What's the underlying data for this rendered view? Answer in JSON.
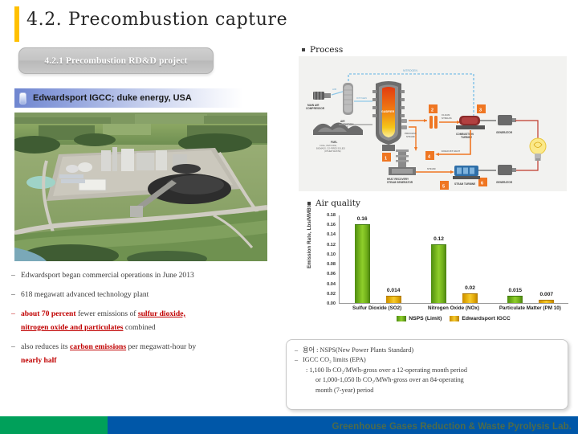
{
  "slide": {
    "title": "4.2. Precombustion capture",
    "subsection": "4.2.1 Precombustion RD&D project",
    "project_label": "Edwardsport IGCC; duke energy, USA",
    "accent_color": "#FFC000"
  },
  "sections": {
    "process_heading": "Process",
    "air_quality_heading": "Air quality"
  },
  "process_diagram": {
    "nitrogen_label": "NITROGEN",
    "air_label": "AIR",
    "oxygen_label": "OXYGEN",
    "clean_syngas_label": "CLEAN SYNGAS",
    "process_steam_label": "PROCESS STEAM",
    "exhaust_heat_label": "EXHAUST HEAT",
    "steam_label": "STEAM",
    "main_air_compressor": "MAIN AIR COMPRESSOR",
    "air_separation_unit": "AIR SEPARATION UNIT",
    "gasifier": "GASIFIER",
    "fuel_label": "FUEL",
    "fuel_sub": "COAL, PETCOKE, BIOMASS, CO-FIRED SOLIDS (OTHER WASTE)",
    "combustion_turbine": "COMBUSTION TURBINE",
    "generator": "GENERATOR",
    "heat_recovery": "HEAT RECOVERY STEAM GENERATOR",
    "steam_turbine": "STEAM TURBINE",
    "step_numbers": [
      "1",
      "2",
      "3",
      "4",
      "5",
      "6"
    ]
  },
  "bullets": [
    {
      "marker": "–",
      "marker_red": false,
      "parts": [
        {
          "text": "Edwardsport began commercial operations in June 2013",
          "style": "plain"
        }
      ]
    },
    {
      "marker": "–",
      "marker_red": false,
      "parts": [
        {
          "text": "618 megawatt advanced technology plant",
          "style": "plain"
        }
      ]
    },
    {
      "marker": "–",
      "marker_red": true,
      "parts": [
        {
          "text": "about 70 percent",
          "style": "em-red"
        },
        {
          "text": " fewer emissions of ",
          "style": "plain"
        },
        {
          "text": "sulfur dioxide,",
          "style": "u-red"
        }
      ],
      "continuation": [
        {
          "text": "nitrogen oxide and particulates",
          "style": "u-red"
        },
        {
          "text": " combined",
          "style": "plain"
        }
      ]
    },
    {
      "marker": "–",
      "marker_red": false,
      "parts": [
        {
          "text": "also reduces its ",
          "style": "plain"
        },
        {
          "text": "carbon emissions",
          "style": "u-red"
        },
        {
          "text": " per megawatt-hour by",
          "style": "plain"
        }
      ],
      "continuation": [
        {
          "text": "nearly half",
          "style": "em-red"
        }
      ]
    }
  ],
  "chart_data": {
    "type": "bar",
    "title": "",
    "xlabel": "",
    "ylabel": "Emission Rate, Lbs/MMBtu",
    "ylim": [
      0.0,
      0.18
    ],
    "ytick_labels": [
      "0.18",
      "0.16",
      "0.14",
      "0.12",
      "0.10",
      "0.08",
      "0.06",
      "0.04",
      "0.02",
      "0.00"
    ],
    "grid": false,
    "legend_position": "bottom",
    "categories": [
      "Sulfur Dioxide (SO2)",
      "Nitrogen Oxide (NOx)",
      "Particulate Matter (PM 10)"
    ],
    "series": [
      {
        "name": "NSPS (Limit)",
        "color": "#7FBF20",
        "values": [
          0.16,
          0.12,
          0.015
        ],
        "labels": [
          "0.16",
          "0.12",
          "0.015"
        ]
      },
      {
        "name": "Edwardsport IGCC",
        "color": "#E8AE00",
        "values": [
          0.014,
          0.02,
          0.007
        ],
        "labels": [
          "0.014",
          "0.02",
          "0.007"
        ]
      }
    ]
  },
  "callout": {
    "lines": [
      {
        "dash": "–",
        "text": "용어 : NSPS(New Power Plants Standard)",
        "indent": 0
      },
      {
        "dash": "–",
        "text": "IGCC CO₂ limits (EPA)",
        "indent": 0
      },
      {
        "dash": "",
        "text": ": 1,100 lb CO₂/MWh-gross over a 12-operating month period",
        "indent": 1
      },
      {
        "dash": "",
        "text": "or 1,000-1,050 lb CO₂/MWh-gross over an 84-operating",
        "indent": 2
      },
      {
        "dash": "",
        "text": "month (7-year) period",
        "indent": 2
      }
    ]
  },
  "footer": {
    "text": "Greenhouse Gases Reduction & Waste Pyrolysis Lab.",
    "green_color": "#00A05A",
    "blue_color": "#0057A8"
  }
}
